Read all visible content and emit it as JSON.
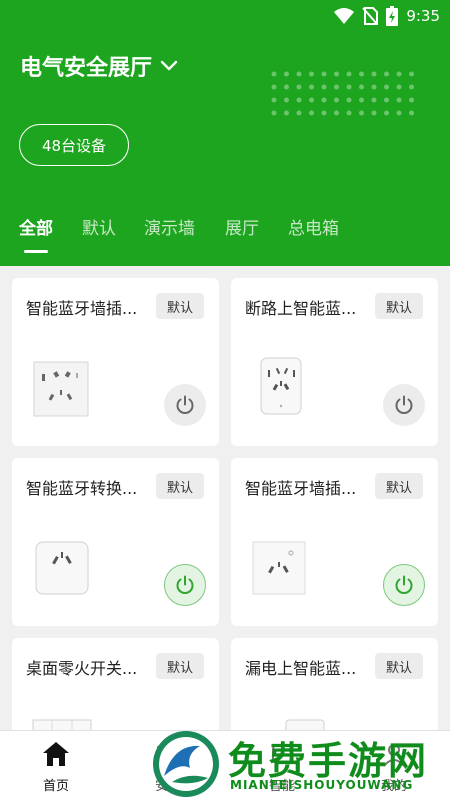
{
  "status_bar": {
    "time": "9:35"
  },
  "header": {
    "title": "电气安全展厅",
    "device_count": "48台设备"
  },
  "tabs": [
    {
      "label": "全部",
      "active": true
    },
    {
      "label": "默认",
      "active": false
    },
    {
      "label": "演示墙",
      "active": false
    },
    {
      "label": "展厅",
      "active": false
    },
    {
      "label": "总电箱",
      "active": false
    }
  ],
  "devices": [
    {
      "name": "智能蓝牙墙插...",
      "tag": "默认",
      "power": "off"
    },
    {
      "name": "断路上智能蓝...",
      "tag": "默认",
      "power": "off"
    },
    {
      "name": "智能蓝牙转换...",
      "tag": "默认",
      "power": "on"
    },
    {
      "name": "智能蓝牙墙插...",
      "tag": "默认",
      "power": "on"
    },
    {
      "name": "桌面零火开关...",
      "tag": "默认",
      "power": "off"
    },
    {
      "name": "漏电上智能蓝...",
      "tag": "默认",
      "power": "off"
    }
  ],
  "bottom_nav": [
    {
      "label": "首页",
      "icon": "home-icon",
      "active": true
    },
    {
      "label": "安全",
      "icon": "shield-icon",
      "active": false
    },
    {
      "label": "智能",
      "icon": "smart-icon",
      "active": false
    },
    {
      "label": "我的",
      "icon": "user-icon",
      "active": false
    }
  ],
  "watermark": {
    "title": "免费手游网",
    "subtitle": "MIANFEISHOUYOUWANG"
  },
  "colors": {
    "brand": "#1ea51f",
    "power_on": "#2fa52f",
    "power_off": "#666666"
  }
}
